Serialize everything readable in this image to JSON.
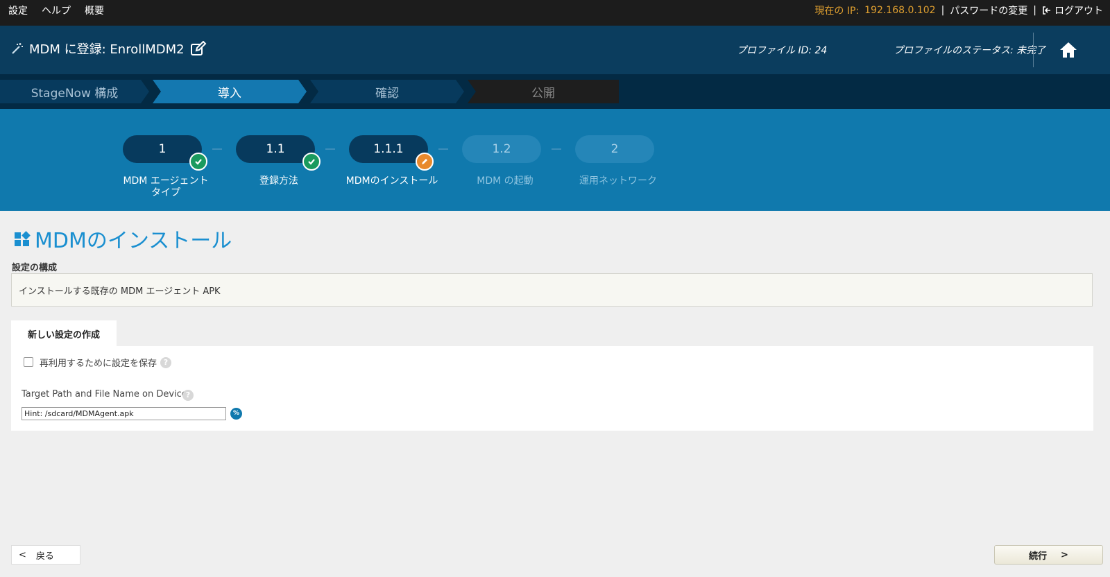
{
  "topbar": {
    "menu": [
      "設定",
      "ヘルプ",
      "概要"
    ],
    "ip_label": "現在の IP:",
    "ip_value": "192.168.0.102",
    "separator": "|",
    "change_password": "パスワードの変更",
    "logout": "ログアウト"
  },
  "header": {
    "title": "MDM に登録: EnrollMDM2",
    "profile_id": "プロファイル ID: 24",
    "profile_status": "プロファイルのステータス: 未完了"
  },
  "wizard_tabs": [
    {
      "label": "StageNow 構成",
      "state": "past"
    },
    {
      "label": "導入",
      "state": "active"
    },
    {
      "label": "確認",
      "state": "upcoming"
    },
    {
      "label": "公開",
      "state": "disabled"
    }
  ],
  "steps": [
    {
      "number": "1",
      "label": "MDM エージェント\nタイプ",
      "status": "complete"
    },
    {
      "number": "1.1",
      "label": "登録方法",
      "status": "complete"
    },
    {
      "number": "1.1.1",
      "label": "MDMのインストール",
      "status": "editing"
    },
    {
      "number": "1.2",
      "label": "MDM の起動",
      "status": "pending"
    },
    {
      "number": "2",
      "label": "運用ネットワーク",
      "status": "pending"
    }
  ],
  "content": {
    "page_title": "MDMのインストール",
    "section_label": "設定の構成",
    "config_value": "インストールする既存の MDM エージェント APK",
    "tab_label": "新しい設定の作成",
    "save_checkbox_label": "再利用するために設定を保存",
    "save_checkbox_checked": false,
    "help_glyph": "?",
    "target_path_label": "Target Path and File Name on Device",
    "target_path_value": "Hint: /sdcard/MDMAgent.apk",
    "percent_glyph": "%"
  },
  "footer": {
    "back_arrow": "<",
    "back_label": "戻る",
    "next_label": "続行",
    "next_arrow": ">"
  },
  "colors": {
    "topbar": "#1c1c1c",
    "header": "#0b3d5e",
    "tabs_bar": "#032a44",
    "tab_active": "#1478b0",
    "steps_band": "#1079ad",
    "step_done": "#073a5d",
    "badge_complete": "#1a9a5e",
    "badge_editing": "#e8892c",
    "accent_title": "#1a8fd0",
    "ip_text": "#e0a030"
  },
  "icons": {
    "header_title": "magic-wand-icon",
    "header_edit": "edit-icon",
    "home": "home-icon",
    "logout": "logout-icon",
    "page_title": "grid-squares-icon"
  }
}
